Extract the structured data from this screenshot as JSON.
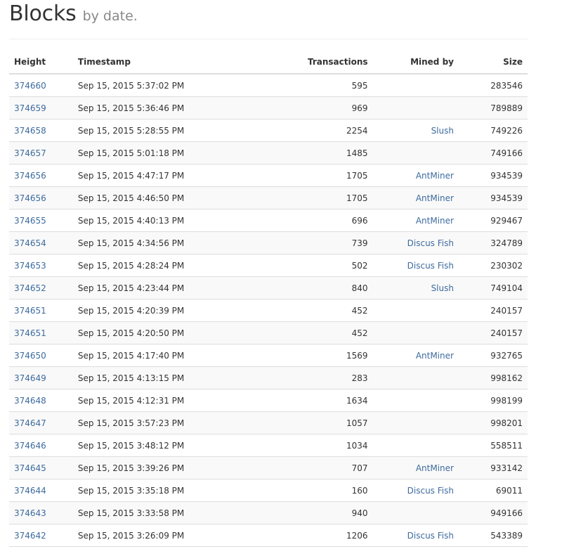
{
  "header": {
    "title": "Blocks",
    "subtitle": "by date."
  },
  "table": {
    "columns": [
      "Height",
      "Timestamp",
      "Transactions",
      "Mined by",
      "Size"
    ],
    "rows": [
      {
        "height": "374660",
        "timestamp": "Sep 15, 2015 5:37:02 PM",
        "transactions": "595",
        "mined_by": "",
        "size": "283546"
      },
      {
        "height": "374659",
        "timestamp": "Sep 15, 2015 5:36:46 PM",
        "transactions": "969",
        "mined_by": "",
        "size": "789889"
      },
      {
        "height": "374658",
        "timestamp": "Sep 15, 2015 5:28:55 PM",
        "transactions": "2254",
        "mined_by": "Slush",
        "size": "749226"
      },
      {
        "height": "374657",
        "timestamp": "Sep 15, 2015 5:01:18 PM",
        "transactions": "1485",
        "mined_by": "",
        "size": "749166"
      },
      {
        "height": "374656",
        "timestamp": "Sep 15, 2015 4:47:17 PM",
        "transactions": "1705",
        "mined_by": "AntMiner",
        "size": "934539"
      },
      {
        "height": "374656",
        "timestamp": "Sep 15, 2015 4:46:50 PM",
        "transactions": "1705",
        "mined_by": "AntMiner",
        "size": "934539"
      },
      {
        "height": "374655",
        "timestamp": "Sep 15, 2015 4:40:13 PM",
        "transactions": "696",
        "mined_by": "AntMiner",
        "size": "929467"
      },
      {
        "height": "374654",
        "timestamp": "Sep 15, 2015 4:34:56 PM",
        "transactions": "739",
        "mined_by": "Discus Fish",
        "size": "324789"
      },
      {
        "height": "374653",
        "timestamp": "Sep 15, 2015 4:28:24 PM",
        "transactions": "502",
        "mined_by": "Discus Fish",
        "size": "230302"
      },
      {
        "height": "374652",
        "timestamp": "Sep 15, 2015 4:23:44 PM",
        "transactions": "840",
        "mined_by": "Slush",
        "size": "749104"
      },
      {
        "height": "374651",
        "timestamp": "Sep 15, 2015 4:20:39 PM",
        "transactions": "452",
        "mined_by": "",
        "size": "240157"
      },
      {
        "height": "374651",
        "timestamp": "Sep 15, 2015 4:20:50 PM",
        "transactions": "452",
        "mined_by": "",
        "size": "240157"
      },
      {
        "height": "374650",
        "timestamp": "Sep 15, 2015 4:17:40 PM",
        "transactions": "1569",
        "mined_by": "AntMiner",
        "size": "932765"
      },
      {
        "height": "374649",
        "timestamp": "Sep 15, 2015 4:13:15 PM",
        "transactions": "283",
        "mined_by": "",
        "size": "998162"
      },
      {
        "height": "374648",
        "timestamp": "Sep 15, 2015 4:12:31 PM",
        "transactions": "1634",
        "mined_by": "",
        "size": "998199"
      },
      {
        "height": "374647",
        "timestamp": "Sep 15, 2015 3:57:23 PM",
        "transactions": "1057",
        "mined_by": "",
        "size": "998201"
      },
      {
        "height": "374646",
        "timestamp": "Sep 15, 2015 3:48:12 PM",
        "transactions": "1034",
        "mined_by": "",
        "size": "558511"
      },
      {
        "height": "374645",
        "timestamp": "Sep 15, 2015 3:39:26 PM",
        "transactions": "707",
        "mined_by": "AntMiner",
        "size": "933142"
      },
      {
        "height": "374644",
        "timestamp": "Sep 15, 2015 3:35:18 PM",
        "transactions": "160",
        "mined_by": "Discus Fish",
        "size": "69011"
      },
      {
        "height": "374643",
        "timestamp": "Sep 15, 2015 3:33:58 PM",
        "transactions": "940",
        "mined_by": "",
        "size": "949166"
      },
      {
        "height": "374642",
        "timestamp": "Sep 15, 2015 3:26:09 PM",
        "transactions": "1206",
        "mined_by": "Discus Fish",
        "size": "543389"
      }
    ]
  },
  "colors": {
    "link": "#3d6b9e",
    "text": "#333333",
    "subtitle": "#888888",
    "row_stripe": "#f9f9f9",
    "border": "#dddddd"
  }
}
